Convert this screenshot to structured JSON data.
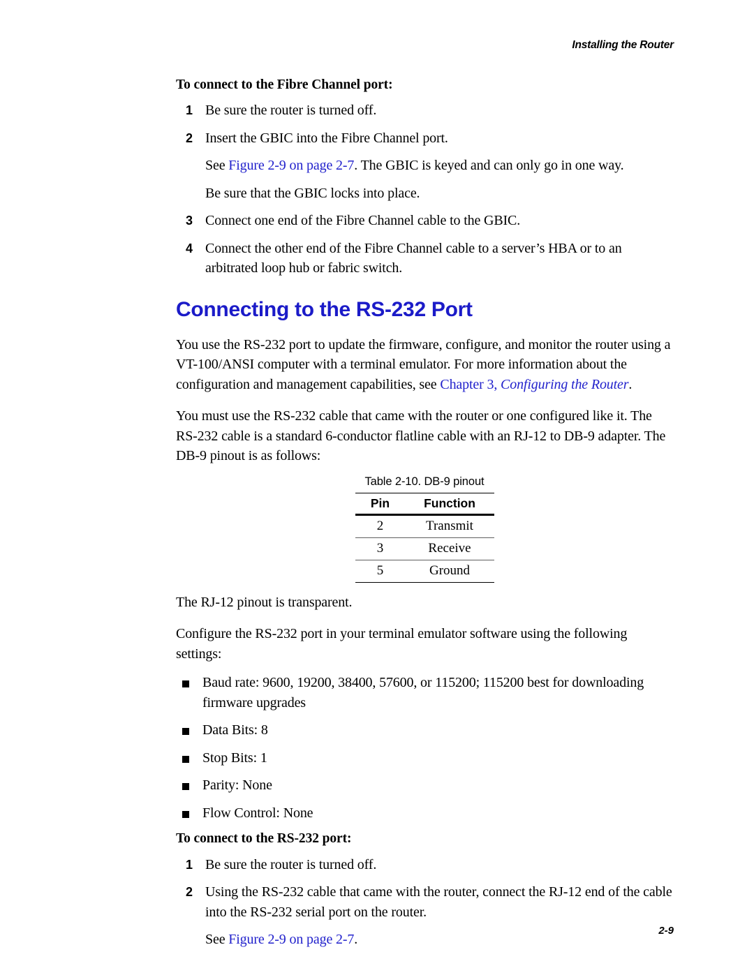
{
  "header": {
    "running_head": "Installing the Router"
  },
  "footer": {
    "page_number": "2-9"
  },
  "colors": {
    "heading_blue": "#1b1bc8",
    "link_blue": "#2222cc",
    "text_black": "#000000"
  },
  "fibre_channel": {
    "run_in_heading": "To connect to the Fibre Channel port:",
    "steps": [
      {
        "number": "1",
        "text": "Be sure the router is turned off."
      },
      {
        "number": "2",
        "text": "Insert the GBIC into the Fibre Channel port."
      },
      {
        "number": "3",
        "text": "Connect one end of the Fibre Channel cable to the GBIC."
      },
      {
        "number": "4",
        "text": "Connect the other end of the Fibre Channel cable to a server’s HBA or to an arbitrated loop hub or fabric switch."
      }
    ],
    "step2_sub_prefix": "See ",
    "step2_sub_link": "Figure 2-9 on page 2-7",
    "step2_sub_suffix": ". The GBIC is keyed and can only go in one way.",
    "step2_sub_line2": "Be sure that the GBIC locks into place."
  },
  "rs232_section": {
    "heading": "Connecting to the RS-232 Port",
    "para1_part1": "You use the RS-232 port to update the firmware, configure, and monitor the router using a VT-100/ANSI computer with a terminal emulator. For more information about the configuration and management capabilities, see ",
    "para1_link_plain": "Chapter 3, ",
    "para1_link_italic": "Configuring the Router",
    "para1_part2": ".",
    "para2": "You must use the RS-232 cable that came with the router or one configured like it. The RS-232 cable is a standard 6-conductor flatline cable with an RJ-12 to DB-9 adapter. The DB-9 pinout is as follows:",
    "para3": "The RJ-12 pinout is transparent.",
    "para4": "Configure the RS-232 port in your terminal emulator software using the following settings:"
  },
  "pinout_table": {
    "caption": "Table 2-10. DB-9 pinout",
    "columns": [
      "Pin",
      "Function"
    ],
    "rows": [
      {
        "pin": "2",
        "function": "Transmit"
      },
      {
        "pin": "3",
        "function": "Receive"
      },
      {
        "pin": "5",
        "function": "Ground"
      }
    ]
  },
  "settings_bullets": [
    "Baud rate: 9600, 19200, 38400, 57600, or 115200; 115200 best for downloading firmware upgrades",
    "Data Bits: 8",
    "Stop Bits: 1",
    "Parity: None",
    "Flow Control: None"
  ],
  "rs232_connect": {
    "run_in_heading": "To connect to the RS-232 port:",
    "steps": [
      {
        "number": "1",
        "text": "Be sure the router is turned off."
      },
      {
        "number": "2",
        "text": "Using the RS-232 cable that came with the router, connect the RJ-12 end of the cable into the RS-232 serial port on the router."
      }
    ],
    "see_prefix": "See ",
    "see_link": "Figure 2-9 on page 2-7",
    "see_suffix": "."
  }
}
